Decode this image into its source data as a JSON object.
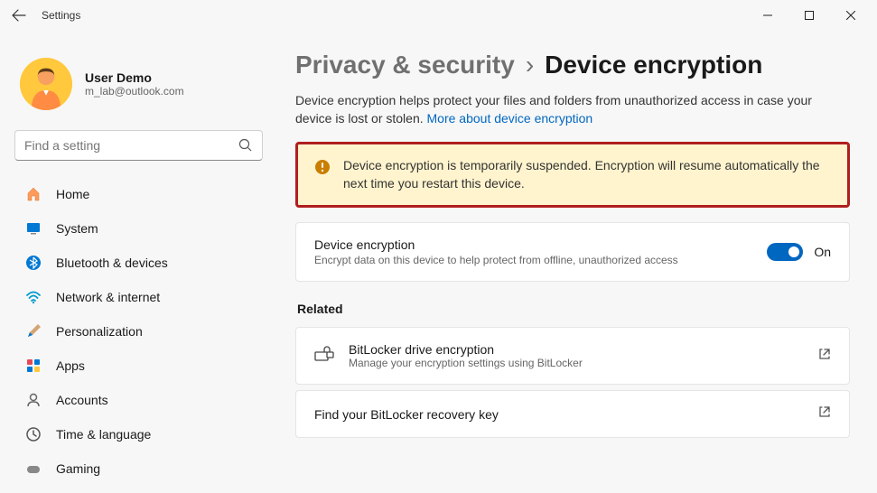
{
  "window": {
    "title": "Settings"
  },
  "user": {
    "name": "User Demo",
    "email": "m_lab@outlook.com"
  },
  "search": {
    "placeholder": "Find a setting"
  },
  "nav": {
    "items": [
      {
        "label": "Home"
      },
      {
        "label": "System"
      },
      {
        "label": "Bluetooth & devices"
      },
      {
        "label": "Network & internet"
      },
      {
        "label": "Personalization"
      },
      {
        "label": "Apps"
      },
      {
        "label": "Accounts"
      },
      {
        "label": "Time & language"
      },
      {
        "label": "Gaming"
      }
    ]
  },
  "breadcrumb": {
    "parent": "Privacy & security",
    "sep": "›",
    "current": "Device encryption"
  },
  "description": {
    "text": "Device encryption helps protect your files and folders from unauthorized access in case your device is lost or stolen. ",
    "link": "More about device encryption"
  },
  "alert": {
    "text": "Device encryption is temporarily suspended. Encryption will resume automatically the next time you restart this device."
  },
  "setting": {
    "title": "Device encryption",
    "subtitle": "Encrypt data on this device to help protect from offline, unauthorized access",
    "toggle_label": "On"
  },
  "related": {
    "header": "Related",
    "items": [
      {
        "title": "BitLocker drive encryption",
        "subtitle": "Manage your encryption settings using BitLocker"
      },
      {
        "title": "Find your BitLocker recovery key",
        "subtitle": ""
      }
    ]
  },
  "colors": {
    "accent": "#0067c0",
    "alert_bg": "#fff4ce",
    "alert_border": "#b01e1e"
  }
}
